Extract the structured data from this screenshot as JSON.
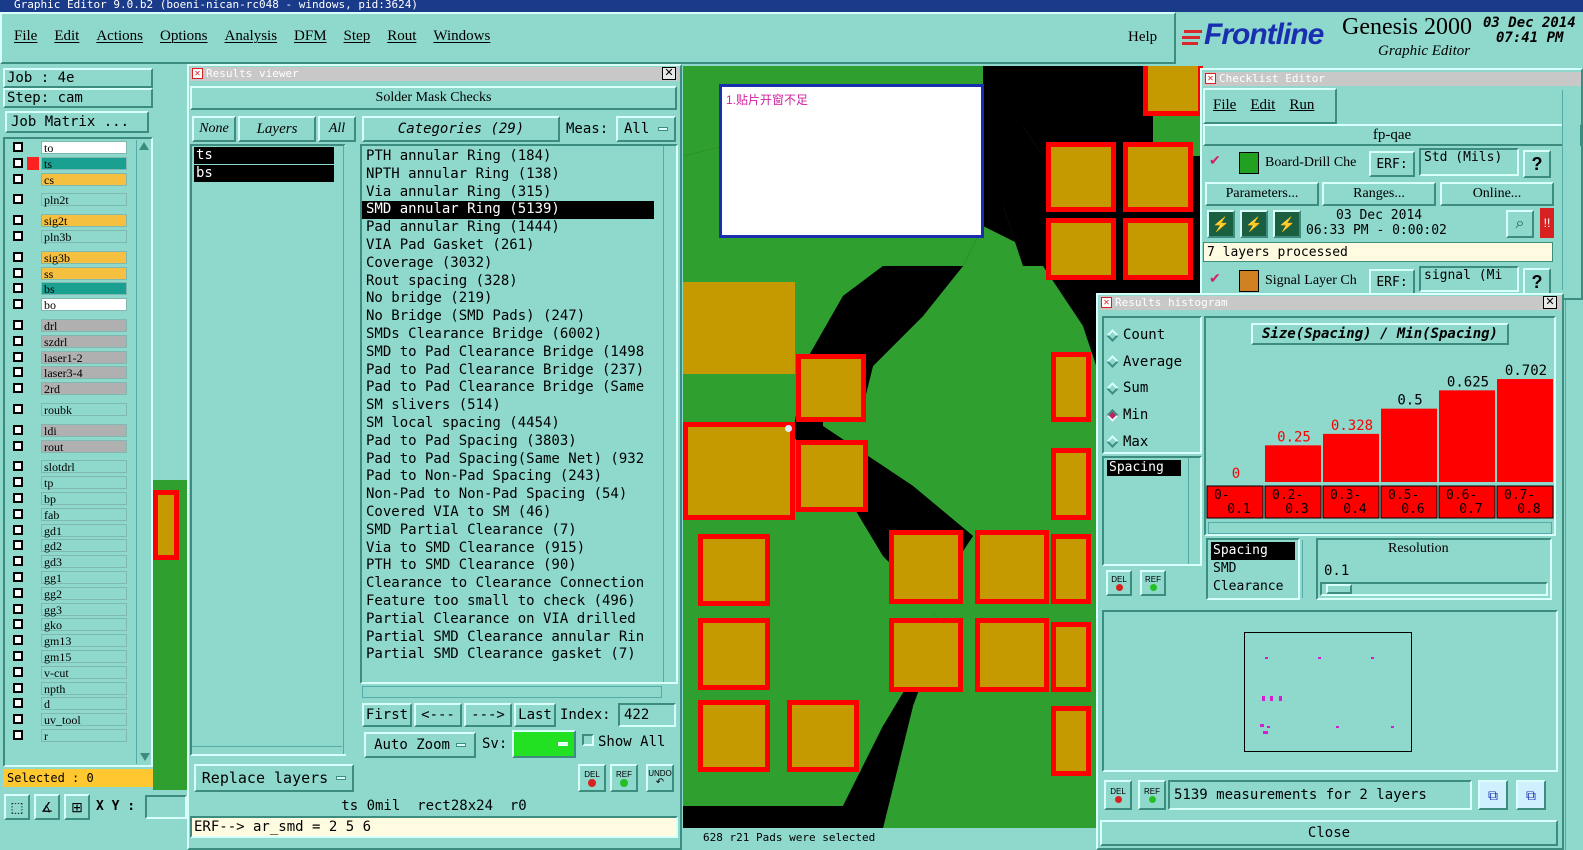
{
  "window": {
    "title": "Graphic Editor 9.0.b2 (boeni-nican-rc048 - windows, pid:3624)"
  },
  "menu": [
    "File",
    "Edit",
    "Actions",
    "Options",
    "Analysis",
    "DFM",
    "Step",
    "Rout",
    "Windows"
  ],
  "help_label": "Help",
  "brand": {
    "logo": "Frontline",
    "product": "Genesis 2000",
    "subtitle": "Graphic Editor",
    "date": "03 Dec 2014",
    "time": "07:41 PM"
  },
  "job": {
    "job_label": "Job : 4e",
    "step_label": "Step: cam",
    "matrix_button": "Job Matrix ...",
    "selected": "Selected : 0"
  },
  "layers": [
    {
      "name": "to",
      "color": "#ffffff"
    },
    {
      "name": "ts",
      "color": "#1aa090"
    },
    {
      "name": "cs",
      "color": "#f5c040"
    },
    {
      "name": "pln2t",
      "color": "#8ed8cc"
    },
    {
      "name": "sig2t",
      "color": "#f5c040"
    },
    {
      "name": "pln3b",
      "color": "#8ed8cc"
    },
    {
      "name": "sig3b",
      "color": "#f5c040"
    },
    {
      "name": "ss",
      "color": "#f5c040"
    },
    {
      "name": "bs",
      "color": "#1aa090"
    },
    {
      "name": "bo",
      "color": "#ffffff"
    },
    {
      "name": "drl",
      "color": "#b0b0b0"
    },
    {
      "name": "szdrl",
      "color": "#b0b0b0"
    },
    {
      "name": "laser1-2",
      "color": "#b0b0b0"
    },
    {
      "name": "laser3-4",
      "color": "#b0b0b0"
    },
    {
      "name": "2rd",
      "color": "#b0b0b0"
    },
    {
      "name": "roubk",
      "color": "#8ed8cc"
    },
    {
      "name": "ldi",
      "color": "#b0b0b0"
    },
    {
      "name": "rout",
      "color": "#b0b0b0"
    },
    {
      "name": "slotdrl",
      "color": "#8ed8cc"
    },
    {
      "name": "tp",
      "color": "#8ed8cc"
    },
    {
      "name": "bp",
      "color": "#8ed8cc"
    },
    {
      "name": "fab",
      "color": "#8ed8cc"
    },
    {
      "name": "gd1",
      "color": "#8ed8cc"
    },
    {
      "name": "gd2",
      "color": "#8ed8cc"
    },
    {
      "name": "gd3",
      "color": "#8ed8cc"
    },
    {
      "name": "gg1",
      "color": "#8ed8cc"
    },
    {
      "name": "gg2",
      "color": "#8ed8cc"
    },
    {
      "name": "gg3",
      "color": "#8ed8cc"
    },
    {
      "name": "gko",
      "color": "#8ed8cc"
    },
    {
      "name": "gm13",
      "color": "#8ed8cc"
    },
    {
      "name": "gm15",
      "color": "#8ed8cc"
    },
    {
      "name": "v-cut",
      "color": "#8ed8cc"
    },
    {
      "name": "npth",
      "color": "#8ed8cc"
    },
    {
      "name": "d",
      "color": "#8ed8cc"
    },
    {
      "name": "uv_tool",
      "color": "#8ed8cc"
    },
    {
      "name": "r",
      "color": "#8ed8cc"
    }
  ],
  "results": {
    "title": "Results viewer",
    "header": "Solder Mask Checks",
    "none_label": "None",
    "layers_label": "Layers",
    "all_label": "All",
    "layer_list": [
      "ts",
      "bs"
    ],
    "categories_label": "Categories (29)",
    "meas_label": "Meas:",
    "meas_value": "All",
    "categories": [
      "PTH annular Ring (184)",
      "NPTH annular Ring (138)",
      "Via annular Ring (315)",
      "SMD annular Ring (5139)",
      "Pad annular Ring (1444)",
      "VIA Pad Gasket (261)",
      "Coverage (3032)",
      "Rout spacing (328)",
      "No bridge (219)",
      "No Bridge (SMD Pads) (247)",
      "SMDs Clearance Bridge (6002)",
      "SMD to Pad Clearance Bridge (1498",
      "Pad to Pad Clearance Bridge (237)",
      "Pad to Pad Clearance Bridge (Same",
      "SM slivers (514)",
      "SM local spacing (4454)",
      "Pad to Pad Spacing (3803)",
      "Pad to Pad Spacing(Same Net) (932",
      "Pad to Non-Pad Spacing (243)",
      "Non-Pad to Non-Pad Spacing (54)",
      "Covered VIA to SM (46)",
      "SMD Partial Clearance (7)",
      "Via to SMD Clearance (915)",
      "PTH to SMD Clearance (90)",
      "Clearance to Clearance Connection",
      "Feature too small to check (496)",
      "Partial Clearance on VIA drilled",
      "Partial SMD Clearance annular Rin",
      "Partial SMD Clearance gasket (7)"
    ],
    "selected_index": 3,
    "first": "First",
    "prev": "<---",
    "next": "--->",
    "last": "Last",
    "index_label": "Index:",
    "index_value": "422",
    "auto_zoom": "Auto Zoom",
    "sv_label": "Sv:",
    "show_all": "Show All",
    "replace_layers": "Replace layers",
    "del": "DEL",
    "ref": "REF",
    "undo": "UNDO",
    "status": "ts 0mil  rect28x24  r0",
    "erf_line": "ERF--> ar_smd = 2 5 6"
  },
  "canvas": {
    "note": "1.贴片开窗不足",
    "bottom_status": "628 r21 Pads were selected"
  },
  "xy": {
    "label": "X Y :",
    "value": ""
  },
  "checklist": {
    "title": "Checklist Editor",
    "menu": [
      "File",
      "Edit",
      "Run"
    ],
    "name": "fp-qae",
    "item1_name": "Board-Drill Che",
    "erf_label": "ERF:",
    "item1_erf": "Std (Mils)",
    "parameters": "Parameters...",
    "ranges": "Ranges...",
    "online": "Online...",
    "item1_date": "03 Dec 2014",
    "item1_time": "06:33 PM - 0:00:02",
    "item1_status": "7 layers processed",
    "item2_name": "Signal Layer Ch",
    "item2_erf": "signal (Mi"
  },
  "histogram": {
    "title": "Results histogram",
    "modes": [
      "Count",
      "Average",
      "Sum",
      "Min",
      "Max"
    ],
    "selected_mode": "Min",
    "left_list": [
      "Spacing"
    ],
    "measure_list": [
      "Spacing",
      "SMD",
      "Clearance"
    ],
    "resolution_label": "Resolution",
    "resolution_value": "0.1",
    "summary": "5139 measurements for 2 layers",
    "close": "Close"
  },
  "chart_data": {
    "type": "bar",
    "title": "Size(Spacing) / Min(Spacing)",
    "categories": [
      "0-\n0.1",
      "0.2-\n0.3",
      "0.3-\n0.4",
      "0.5-\n0.6",
      "0.6-\n0.7",
      "0.7-\n0.8"
    ],
    "category_top": [
      "0-",
      "0.2-",
      "0.3-",
      "0.5-",
      "0.6-",
      "0.7-"
    ],
    "category_bottom": [
      "0.1",
      "0.3",
      "0.4",
      "0.6",
      "0.7",
      "0.8"
    ],
    "values": [
      0,
      0.25,
      0.328,
      0.5,
      0.625,
      0.702
    ],
    "labels": [
      "0",
      "0.25",
      "0.328",
      "0.5",
      "0.625",
      "0.702"
    ],
    "ylim": [
      0,
      0.75
    ],
    "bar_color": "#ff0000",
    "label_colors": [
      "#ff0000",
      "#ff0000",
      "#ff0000",
      "#000000",
      "#000000",
      "#000000"
    ]
  }
}
